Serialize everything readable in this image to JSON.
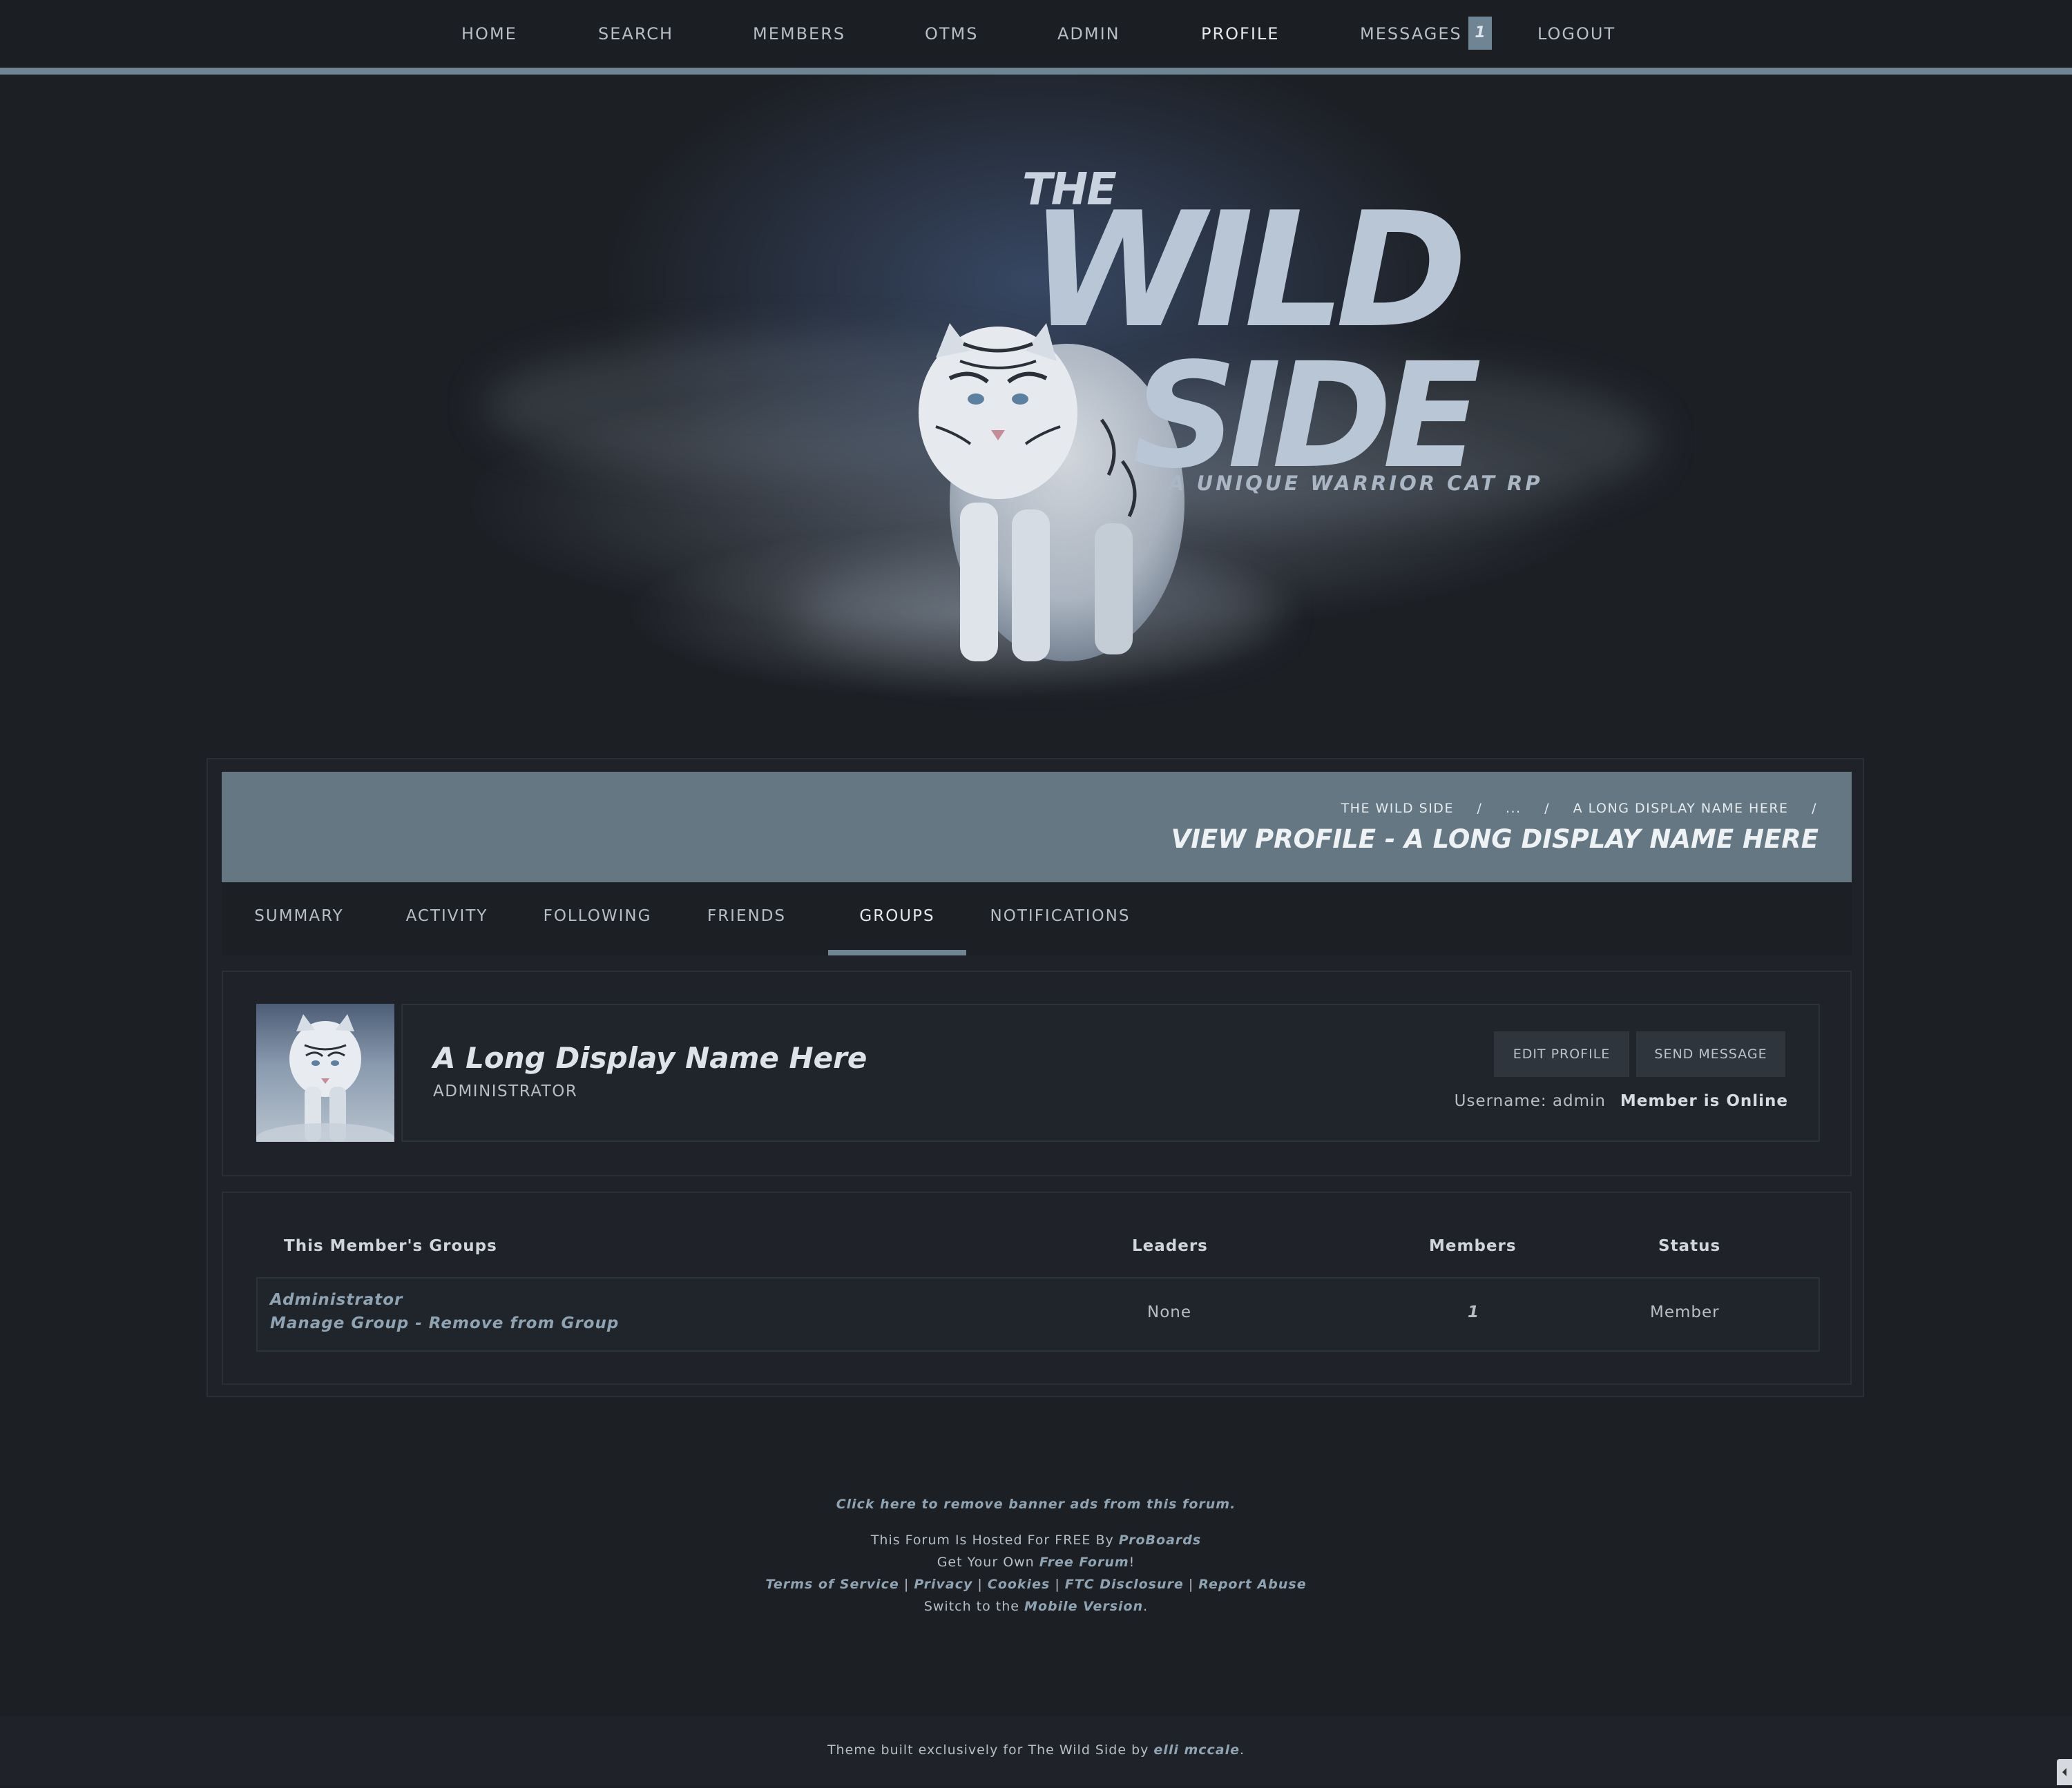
{
  "nav": {
    "items": [
      {
        "label": "HOME"
      },
      {
        "label": "SEARCH"
      },
      {
        "label": "MEMBERS"
      },
      {
        "label": "OTMS"
      },
      {
        "label": "ADMIN"
      },
      {
        "label": "PROFILE"
      },
      {
        "label": "MESSAGES"
      },
      {
        "label": "LOGOUT"
      }
    ],
    "active": "PROFILE",
    "messages_count": "1"
  },
  "banner": {
    "logo_the": "THE",
    "logo_wild": "WILD",
    "logo_side": "SIDE",
    "logo_tagline": "A UNIQUE WARRIOR CAT RP"
  },
  "header": {
    "breadcrumbs": [
      "THE WILD SIDE",
      "...",
      "A LONG DISPLAY NAME HERE"
    ],
    "breadcrumb_separator": "/",
    "title": "VIEW PROFILE - A LONG DISPLAY NAME HERE"
  },
  "tabs": {
    "items": [
      {
        "label": "SUMMARY"
      },
      {
        "label": "ACTIVITY"
      },
      {
        "label": "FOLLOWING"
      },
      {
        "label": "FRIENDS"
      },
      {
        "label": "GROUPS"
      },
      {
        "label": "NOTIFICATIONS"
      }
    ],
    "active": "GROUPS"
  },
  "profile": {
    "display_name": "A Long Display Name Here",
    "rank": "ADMINISTRATOR",
    "edit_label": "EDIT PROFILE",
    "message_label": "SEND MESSAGE",
    "username": "Username: admin",
    "status": "Member is Online"
  },
  "groups": {
    "headers": {
      "group": "This Member's Groups",
      "leaders": "Leaders",
      "members": "Members",
      "status": "Status"
    },
    "rows": [
      {
        "name": "Administrator",
        "manage": "Manage Group",
        "separator": " - ",
        "remove": "Remove from Group",
        "leaders": "None",
        "members": "1",
        "status": "Member"
      }
    ]
  },
  "footer": {
    "remove_ads": "Click here to remove banner ads from this forum.",
    "hosted_prefix": "This Forum Is Hosted For FREE By ",
    "hosted_link": "ProBoards",
    "own_prefix": "Get Your Own ",
    "own_link": "Free Forum",
    "own_suffix": "!",
    "links": [
      "Terms of Service",
      "Privacy",
      "Cookies",
      "FTC Disclosure",
      "Report Abuse"
    ],
    "links_separator": " | ",
    "mobile_prefix": "Switch to the ",
    "mobile_link": "Mobile Version",
    "mobile_suffix": ".",
    "credit_prefix": "Theme built exclusively for The Wild Side by ",
    "credit_link": "elli mccale",
    "credit_suffix": "."
  },
  "colors": {
    "accent": "#6f8593",
    "background": "#1c1f24",
    "link": "#8fa3b3"
  }
}
